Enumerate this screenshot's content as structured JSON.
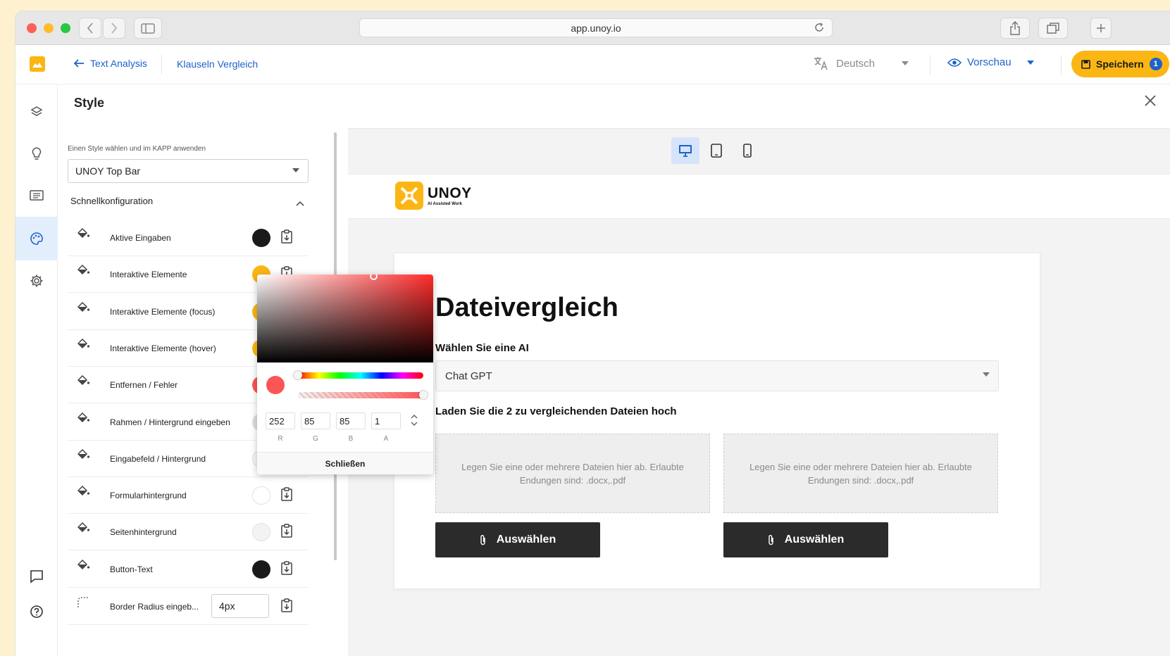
{
  "browser": {
    "url": "app.unoy.io"
  },
  "header": {
    "back_label": "Text Analysis",
    "crumb": "Klauseln Vergleich",
    "language": "Deutsch",
    "preview_label": "Vorschau",
    "save_label": "Speichern",
    "save_badge": "1"
  },
  "style_panel": {
    "title": "Style",
    "select_label": "Einen Style wählen und im KAPP anwenden",
    "selected_style": "UNOY Top Bar",
    "section_title": "Schnellkonfiguration",
    "rows": [
      {
        "label": "Aktive Eingaben",
        "color": "#1a1a1a"
      },
      {
        "label": "Interaktive Elemente",
        "color": "#fbb614"
      },
      {
        "label": "Interaktive Elemente (focus)",
        "color": "#fbb614"
      },
      {
        "label": "Interaktive Elemente (hover)",
        "color": "#fbb614"
      },
      {
        "label": "Entfernen / Fehler",
        "color": "#fc5555"
      },
      {
        "label": "Rahmen / Hintergrund eingeben",
        "color": "#dddddd"
      },
      {
        "label": "Eingabefeld / Hintergrund",
        "color": "#f7f7f7"
      },
      {
        "label": "Formularhintergrund",
        "color": "#ffffff"
      },
      {
        "label": "Seitenhintergrund",
        "color": "#f3f3f3"
      },
      {
        "label": "Button-Text",
        "color": "#1a1a1a"
      }
    ],
    "radius_row": {
      "label": "Border Radius eingeb...",
      "value": "4px"
    }
  },
  "color_picker": {
    "r": "252",
    "g": "85",
    "b": "85",
    "a": "1",
    "r_label": "R",
    "g_label": "G",
    "b_label": "B",
    "a_label": "A",
    "close_label": "Schließen",
    "current_color": "#fc5555"
  },
  "preview": {
    "logo_word": "UNOY",
    "logo_tagline": "AI Assisted Work",
    "title": "Dateivergleich",
    "ai_label": "Wählen Sie eine AI",
    "ai_value": "Chat GPT",
    "upload_label": "Laden Sie die 2 zu vergleichenden Dateien hoch",
    "drop_text": "Legen Sie eine oder mehrere Dateien hier ab. Erlaubte Endungen sind: .docx,.pdf",
    "button_label": "Auswählen"
  },
  "colors": {
    "accent": "#fbb614",
    "link": "#1d62c9",
    "dark_button": "#2b2b2b"
  }
}
